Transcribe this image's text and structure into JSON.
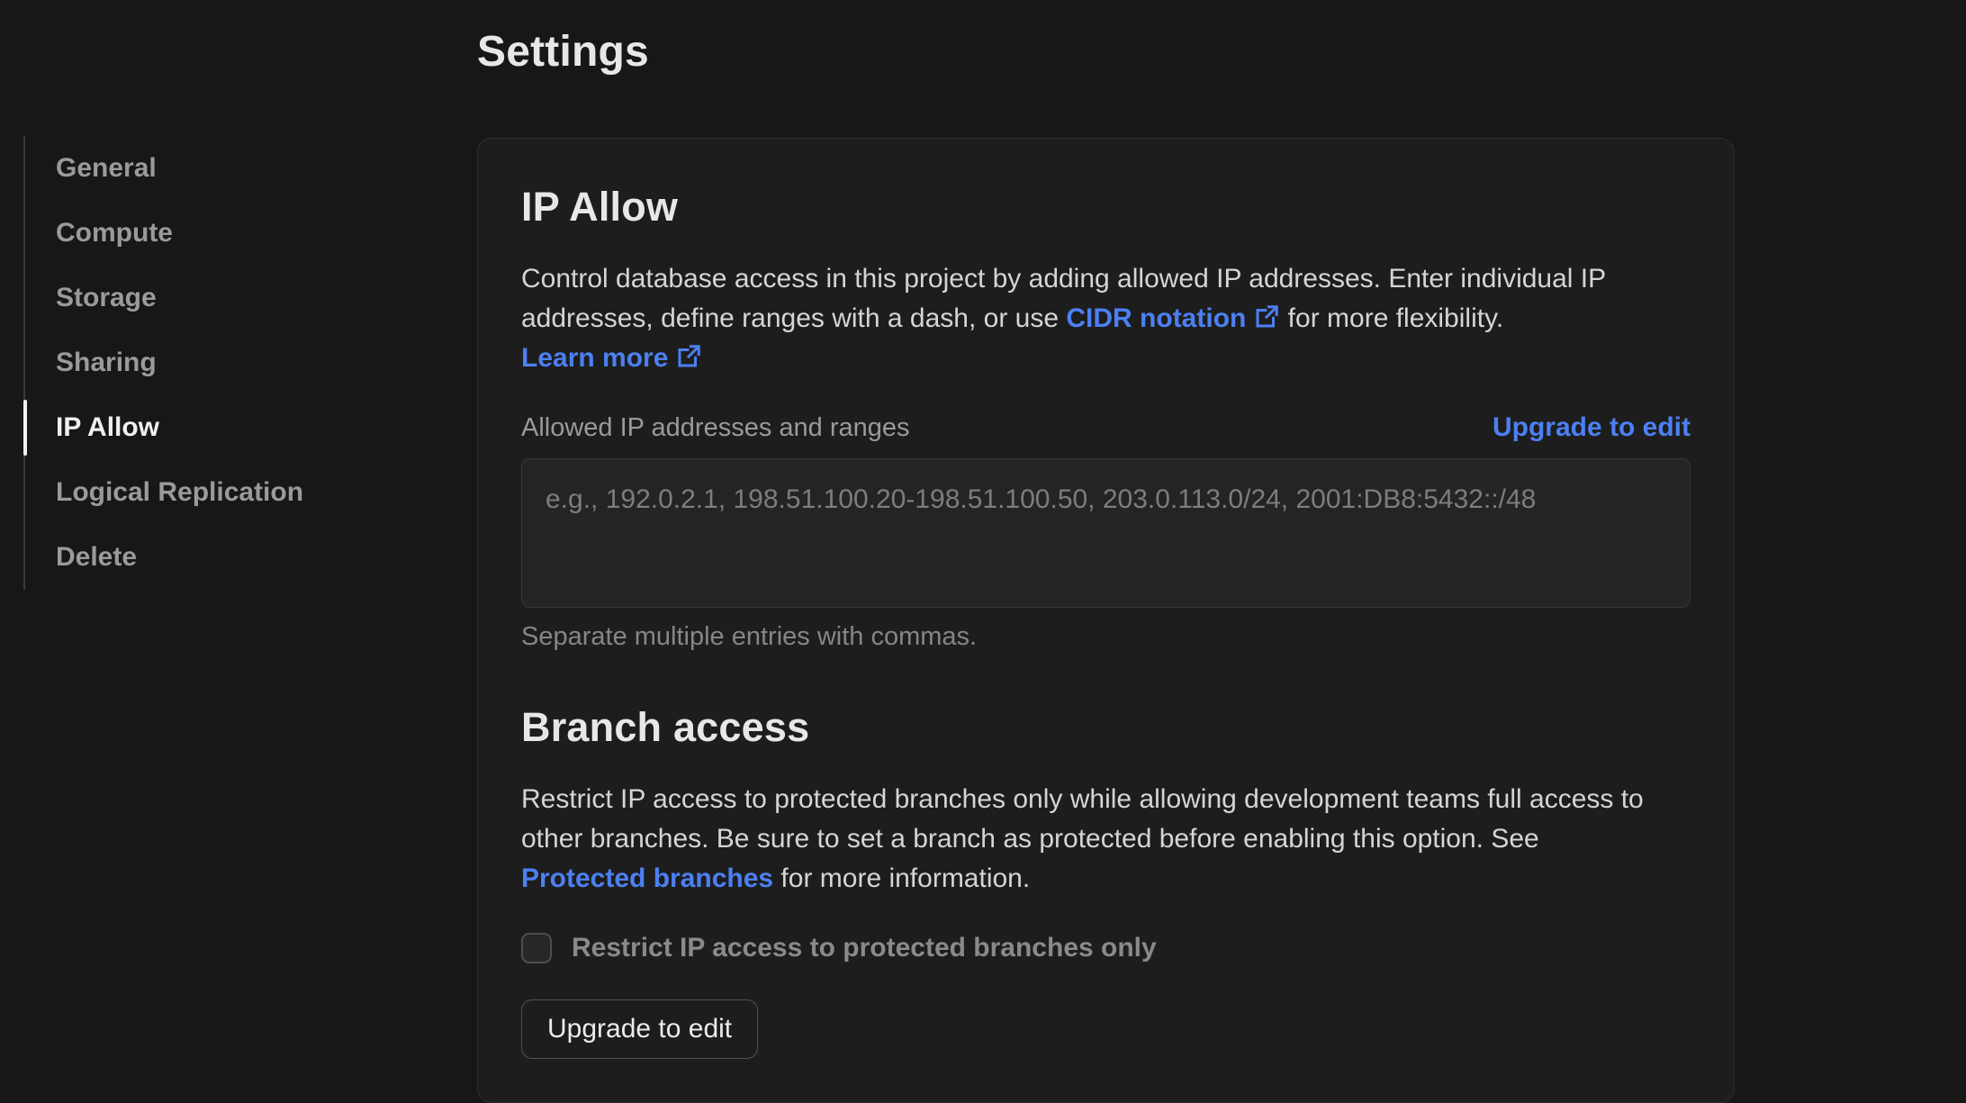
{
  "page": {
    "title": "Settings"
  },
  "sidebar": {
    "items": [
      {
        "label": "General",
        "active": false
      },
      {
        "label": "Compute",
        "active": false
      },
      {
        "label": "Storage",
        "active": false
      },
      {
        "label": "Sharing",
        "active": false
      },
      {
        "label": "IP Allow",
        "active": true
      },
      {
        "label": "Logical Replication",
        "active": false
      },
      {
        "label": "Delete",
        "active": false
      }
    ]
  },
  "ip_allow": {
    "heading": "IP Allow",
    "desc_part1": "Control database access in this project by adding allowed IP addresses. Enter individual IP addresses, define ranges with a dash, or use ",
    "cidr_link_label": "CIDR notation",
    "desc_part2": " for more flexibility. ",
    "learn_more_label": "Learn more",
    "field_label": "Allowed IP addresses and ranges",
    "upgrade_link_label": "Upgrade to edit",
    "textarea_placeholder": "e.g., 192.0.2.1, 198.51.100.20-198.51.100.50, 203.0.113.0/24, 2001:DB8:5432::/48",
    "textarea_value": "",
    "helper_text": "Separate multiple entries with commas."
  },
  "branch_access": {
    "heading": "Branch access",
    "desc_part1": "Restrict IP access to protected branches only while allowing development teams full access to other branches. Be sure to set a branch as protected before enabling this option. See ",
    "protected_link_label": "Protected branches",
    "desc_part2": " for more information.",
    "checkbox_label": "Restrict IP access to protected branches only",
    "checkbox_checked": false,
    "button_label": "Upgrade to edit"
  },
  "colors": {
    "accent_link_blue": "#4c80f2",
    "page_background": "#171717",
    "card_background": "#1d1d1d"
  }
}
